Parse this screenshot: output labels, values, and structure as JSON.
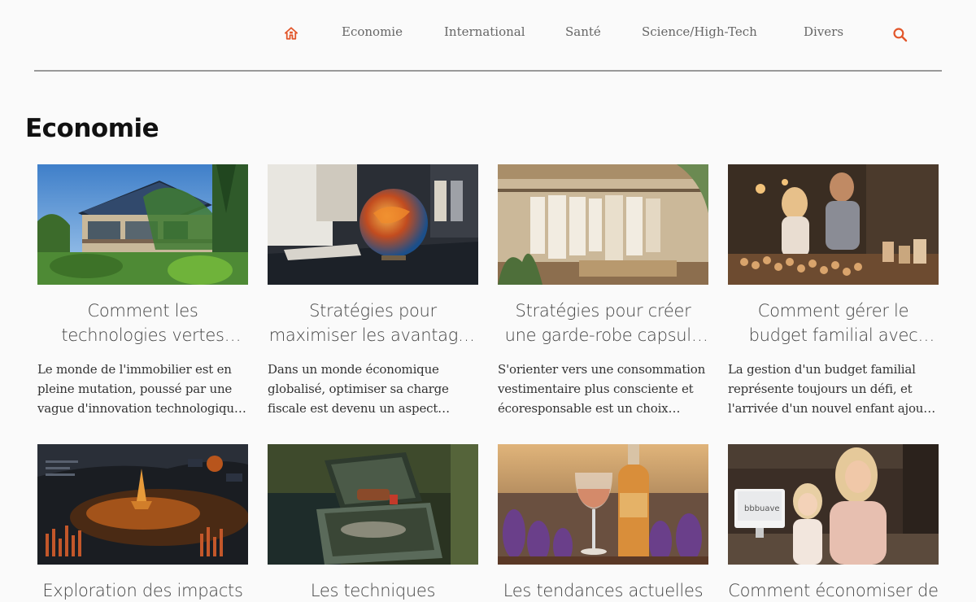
{
  "nav": {
    "items": [
      "Economie",
      "International",
      "Santé",
      "Science/High-Tech",
      "Divers"
    ],
    "accent_color": "#e2562a",
    "icons": {
      "home": "home-icon",
      "search": "search-icon"
    }
  },
  "section": {
    "title": "Economie"
  },
  "articles": [
    {
      "title": "Comment les technologies vertes transforment le marché immobilier",
      "excerpt": "Le monde de l'immobilier est en pleine mutation, poussé par une vague d'innovation technologique qui redéfinit les standards",
      "image": "green-house-with-solar-panels"
    },
    {
      "title": "Stratégies pour maximiser les avantages fiscaux",
      "excerpt": "Dans un monde économique globalisé, optimiser sa charge fiscale est devenu un aspect essentiel de la gestion",
      "image": "glowing-globe-on-desk"
    },
    {
      "title": "Stratégies pour créer une garde-robe capsule écoresponsable",
      "excerpt": "S'orienter vers une consommation vestimentaire plus consciente et écoresponsable est un choix réfléchi",
      "image": "wardrobe-with-neutral-clothes"
    },
    {
      "title": "Comment gérer le budget familial avec l'arrivée d'un nouvel enfant",
      "excerpt": "La gestion d'un budget familial représente toujours un défi, et l'arrivée d'un nouvel enfant ajoute de nouvelles dépenses",
      "image": "family-sorting-goods-on-table"
    },
    {
      "title": "Exploration des impacts",
      "excerpt": "",
      "image": "dashboard-city-landscape"
    },
    {
      "title": "Les techniques",
      "excerpt": "",
      "image": "open-case-in-forest"
    },
    {
      "title": "Les tendances actuelles",
      "excerpt": "",
      "image": "wine-bottle-and-glass-lavender"
    },
    {
      "title": "Comment économiser de",
      "excerpt": "",
      "image": "mother-and-daughter-with-computer"
    }
  ]
}
